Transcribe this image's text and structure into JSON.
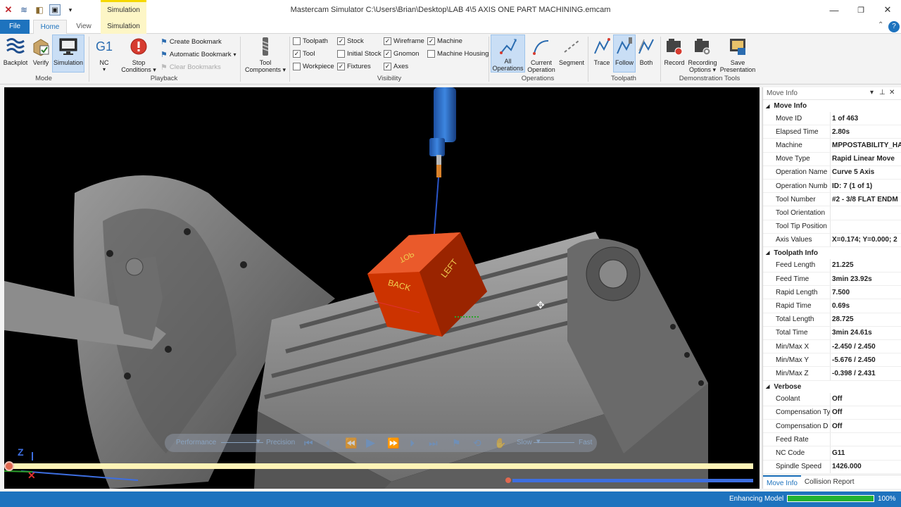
{
  "app": {
    "title": "Mastercam Simulator  C:\\Users\\Brian\\Desktop\\LAB 4\\5 AXIS ONE PART MACHINING.emcam",
    "context_tab": "Simulation"
  },
  "tabs": {
    "file": "File",
    "home": "Home",
    "view": "View",
    "simulation": "Simulation"
  },
  "ribbon": {
    "mode": {
      "label": "Mode",
      "backplot": "Backplot",
      "verify": "Verify",
      "simulation": "Simulation"
    },
    "playback": {
      "label": "Playback",
      "nc": "NC",
      "nc_icon_text": "G1",
      "stop_conditions_1": "Stop",
      "stop_conditions_2": "Conditions",
      "create_bookmark": "Create Bookmark",
      "automatic_bookmark": "Automatic Bookmark",
      "clear_bookmarks": "Clear Bookmarks"
    },
    "tool_components_1": "Tool",
    "tool_components_2": "Components",
    "visibility": {
      "label": "Visibility",
      "items": [
        {
          "label": "Toolpath",
          "checked": false
        },
        {
          "label": "Tool",
          "checked": true
        },
        {
          "label": "Workpiece",
          "checked": false
        },
        {
          "label": "Stock",
          "checked": true
        },
        {
          "label": "Initial Stock",
          "checked": false
        },
        {
          "label": "Fixtures",
          "checked": true
        },
        {
          "label": "Wireframe",
          "checked": true
        },
        {
          "label": "Gnomon",
          "checked": true
        },
        {
          "label": "Axes",
          "checked": true
        },
        {
          "label": "Machine",
          "checked": true
        },
        {
          "label": "Machine Housing",
          "checked": false
        }
      ]
    },
    "operations": {
      "label": "Operations",
      "all_1": "All",
      "all_2": "Operations",
      "current_1": "Current",
      "current_2": "Operation",
      "segment": "Segment"
    },
    "toolpath": {
      "label": "Toolpath",
      "trace": "Trace",
      "follow": "Follow",
      "both": "Both"
    },
    "demo": {
      "label": "Demonstration Tools",
      "record": "Record",
      "recording_1": "Recording",
      "recording_2": "Options",
      "save_1": "Save",
      "save_2": "Presentation"
    }
  },
  "scene": {
    "cube_top": "TOP",
    "cube_back": "BACK",
    "cube_left": "LEFT",
    "gnomon_z": "Z"
  },
  "playbar": {
    "performance": "Performance",
    "precision": "Precision",
    "slow": "Slow",
    "fast": "Fast"
  },
  "panel": {
    "title": "Move Info",
    "sections": [
      {
        "title": "Move Info",
        "rows": [
          {
            "k": "Move ID",
            "v": "1 of 463"
          },
          {
            "k": "Elapsed Time",
            "v": "2.80s"
          },
          {
            "k": "Machine",
            "v": "MPPOSTABILITY_HA"
          },
          {
            "k": "Move Type",
            "v": "Rapid Linear Move"
          },
          {
            "k": "Operation Name",
            "v": "Curve 5 Axis"
          },
          {
            "k": "Operation Numb",
            "v": "ID: 7 (1 of 1)"
          },
          {
            "k": "Tool Number",
            "v": "#2 - 3/8 FLAT ENDM"
          },
          {
            "k": "Tool Orientation",
            "v": ""
          },
          {
            "k": "Tool Tip Position",
            "v": ""
          },
          {
            "k": "Axis Values",
            "v": "X=0.174; Y=0.000; 2"
          }
        ]
      },
      {
        "title": "Toolpath Info",
        "rows": [
          {
            "k": "Feed Length",
            "v": "21.225"
          },
          {
            "k": "Feed Time",
            "v": "3min 23.92s"
          },
          {
            "k": "Rapid Length",
            "v": "7.500"
          },
          {
            "k": "Rapid Time",
            "v": "0.69s"
          },
          {
            "k": "Total Length",
            "v": "28.725"
          },
          {
            "k": "Total Time",
            "v": "3min 24.61s"
          },
          {
            "k": "Min/Max X",
            "v": "-2.450 / 2.450"
          },
          {
            "k": "Min/Max Y",
            "v": "-5.676 / 2.450"
          },
          {
            "k": "Min/Max Z",
            "v": "-0.398 / 2.431"
          }
        ]
      },
      {
        "title": "Verbose",
        "rows": [
          {
            "k": "Coolant",
            "v": "Off"
          },
          {
            "k": "Compensation Ty",
            "v": "Off"
          },
          {
            "k": "Compensation D",
            "v": "Off"
          },
          {
            "k": "Feed Rate",
            "v": ""
          },
          {
            "k": "NC Code",
            "v": "G11"
          },
          {
            "k": "Spindle Speed",
            "v": "1426.000"
          }
        ]
      }
    ],
    "tabs": [
      "Move Info",
      "Collision Report"
    ]
  },
  "status": {
    "text": "Enhancing Model",
    "progress": 1.0,
    "percent": "100%"
  }
}
